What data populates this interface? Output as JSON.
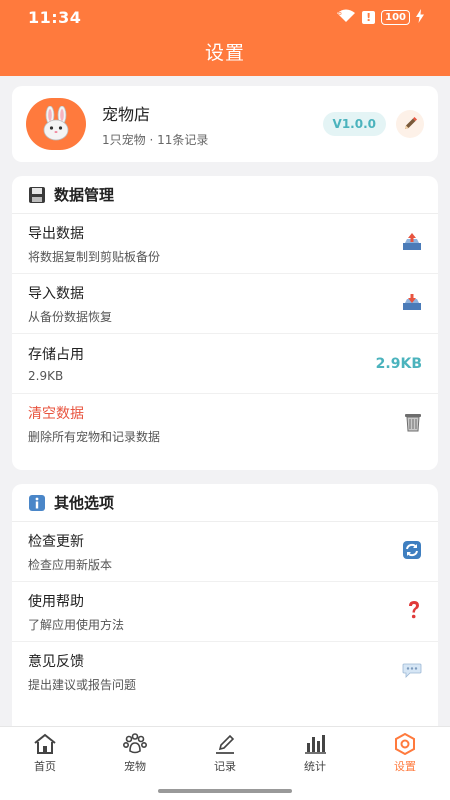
{
  "status": {
    "time": "11:34",
    "battery": "100"
  },
  "header": {
    "title": "设置"
  },
  "profile": {
    "name": "宠物店",
    "summary": "1只宠物 · 11条记录",
    "version": "V1.0.0"
  },
  "data_section": {
    "title": "数据管理",
    "items": [
      {
        "title": "导出数据",
        "desc": "将数据复制到剪贴板备份",
        "icon": "export-tray-icon"
      },
      {
        "title": "导入数据",
        "desc": "从备份数据恢复",
        "icon": "import-tray-icon"
      },
      {
        "title": "存储占用",
        "desc": "2.9KB",
        "value": "2.9KB"
      },
      {
        "title": "清空数据",
        "desc": "删除所有宠物和记录数据",
        "icon": "trash-icon"
      }
    ]
  },
  "other_section": {
    "title": "其他选项",
    "items": [
      {
        "title": "检查更新",
        "desc": "检查应用新版本",
        "icon": "refresh-icon"
      },
      {
        "title": "使用帮助",
        "desc": "了解应用使用方法",
        "icon": "question-icon"
      },
      {
        "title": "意见反馈",
        "desc": "提出建议或报告问题",
        "icon": "speech-bubble-icon"
      }
    ]
  },
  "tabbar": {
    "tabs": [
      {
        "label": "首页",
        "icon": "home-icon"
      },
      {
        "label": "宠物",
        "icon": "paw-icon"
      },
      {
        "label": "记录",
        "icon": "pencil-icon"
      },
      {
        "label": "统计",
        "icon": "bar-chart-icon"
      },
      {
        "label": "设置",
        "icon": "settings-icon"
      }
    ],
    "active": "设置"
  },
  "colors": {
    "accent": "#ff7a3d",
    "teal": "#4bb3bd",
    "danger": "#e8543f"
  }
}
